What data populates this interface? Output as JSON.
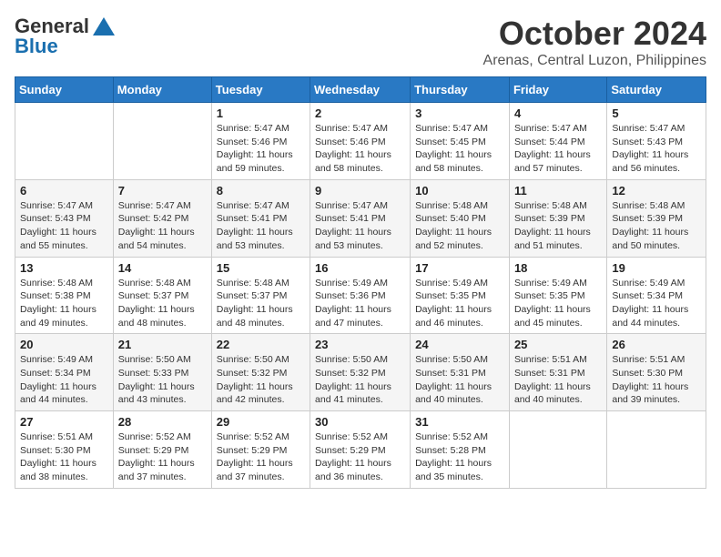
{
  "logo": {
    "general": "General",
    "blue": "Blue"
  },
  "title": {
    "month": "October 2024",
    "location": "Arenas, Central Luzon, Philippines"
  },
  "calendar": {
    "headers": [
      "Sunday",
      "Monday",
      "Tuesday",
      "Wednesday",
      "Thursday",
      "Friday",
      "Saturday"
    ],
    "weeks": [
      [
        {
          "day": "",
          "info": ""
        },
        {
          "day": "",
          "info": ""
        },
        {
          "day": "1",
          "info": "Sunrise: 5:47 AM\nSunset: 5:46 PM\nDaylight: 11 hours\nand 59 minutes."
        },
        {
          "day": "2",
          "info": "Sunrise: 5:47 AM\nSunset: 5:46 PM\nDaylight: 11 hours\nand 58 minutes."
        },
        {
          "day": "3",
          "info": "Sunrise: 5:47 AM\nSunset: 5:45 PM\nDaylight: 11 hours\nand 58 minutes."
        },
        {
          "day": "4",
          "info": "Sunrise: 5:47 AM\nSunset: 5:44 PM\nDaylight: 11 hours\nand 57 minutes."
        },
        {
          "day": "5",
          "info": "Sunrise: 5:47 AM\nSunset: 5:43 PM\nDaylight: 11 hours\nand 56 minutes."
        }
      ],
      [
        {
          "day": "6",
          "info": "Sunrise: 5:47 AM\nSunset: 5:43 PM\nDaylight: 11 hours\nand 55 minutes."
        },
        {
          "day": "7",
          "info": "Sunrise: 5:47 AM\nSunset: 5:42 PM\nDaylight: 11 hours\nand 54 minutes."
        },
        {
          "day": "8",
          "info": "Sunrise: 5:47 AM\nSunset: 5:41 PM\nDaylight: 11 hours\nand 53 minutes."
        },
        {
          "day": "9",
          "info": "Sunrise: 5:47 AM\nSunset: 5:41 PM\nDaylight: 11 hours\nand 53 minutes."
        },
        {
          "day": "10",
          "info": "Sunrise: 5:48 AM\nSunset: 5:40 PM\nDaylight: 11 hours\nand 52 minutes."
        },
        {
          "day": "11",
          "info": "Sunrise: 5:48 AM\nSunset: 5:39 PM\nDaylight: 11 hours\nand 51 minutes."
        },
        {
          "day": "12",
          "info": "Sunrise: 5:48 AM\nSunset: 5:39 PM\nDaylight: 11 hours\nand 50 minutes."
        }
      ],
      [
        {
          "day": "13",
          "info": "Sunrise: 5:48 AM\nSunset: 5:38 PM\nDaylight: 11 hours\nand 49 minutes."
        },
        {
          "day": "14",
          "info": "Sunrise: 5:48 AM\nSunset: 5:37 PM\nDaylight: 11 hours\nand 48 minutes."
        },
        {
          "day": "15",
          "info": "Sunrise: 5:48 AM\nSunset: 5:37 PM\nDaylight: 11 hours\nand 48 minutes."
        },
        {
          "day": "16",
          "info": "Sunrise: 5:49 AM\nSunset: 5:36 PM\nDaylight: 11 hours\nand 47 minutes."
        },
        {
          "day": "17",
          "info": "Sunrise: 5:49 AM\nSunset: 5:35 PM\nDaylight: 11 hours\nand 46 minutes."
        },
        {
          "day": "18",
          "info": "Sunrise: 5:49 AM\nSunset: 5:35 PM\nDaylight: 11 hours\nand 45 minutes."
        },
        {
          "day": "19",
          "info": "Sunrise: 5:49 AM\nSunset: 5:34 PM\nDaylight: 11 hours\nand 44 minutes."
        }
      ],
      [
        {
          "day": "20",
          "info": "Sunrise: 5:49 AM\nSunset: 5:34 PM\nDaylight: 11 hours\nand 44 minutes."
        },
        {
          "day": "21",
          "info": "Sunrise: 5:50 AM\nSunset: 5:33 PM\nDaylight: 11 hours\nand 43 minutes."
        },
        {
          "day": "22",
          "info": "Sunrise: 5:50 AM\nSunset: 5:32 PM\nDaylight: 11 hours\nand 42 minutes."
        },
        {
          "day": "23",
          "info": "Sunrise: 5:50 AM\nSunset: 5:32 PM\nDaylight: 11 hours\nand 41 minutes."
        },
        {
          "day": "24",
          "info": "Sunrise: 5:50 AM\nSunset: 5:31 PM\nDaylight: 11 hours\nand 40 minutes."
        },
        {
          "day": "25",
          "info": "Sunrise: 5:51 AM\nSunset: 5:31 PM\nDaylight: 11 hours\nand 40 minutes."
        },
        {
          "day": "26",
          "info": "Sunrise: 5:51 AM\nSunset: 5:30 PM\nDaylight: 11 hours\nand 39 minutes."
        }
      ],
      [
        {
          "day": "27",
          "info": "Sunrise: 5:51 AM\nSunset: 5:30 PM\nDaylight: 11 hours\nand 38 minutes."
        },
        {
          "day": "28",
          "info": "Sunrise: 5:52 AM\nSunset: 5:29 PM\nDaylight: 11 hours\nand 37 minutes."
        },
        {
          "day": "29",
          "info": "Sunrise: 5:52 AM\nSunset: 5:29 PM\nDaylight: 11 hours\nand 37 minutes."
        },
        {
          "day": "30",
          "info": "Sunrise: 5:52 AM\nSunset: 5:29 PM\nDaylight: 11 hours\nand 36 minutes."
        },
        {
          "day": "31",
          "info": "Sunrise: 5:52 AM\nSunset: 5:28 PM\nDaylight: 11 hours\nand 35 minutes."
        },
        {
          "day": "",
          "info": ""
        },
        {
          "day": "",
          "info": ""
        }
      ]
    ]
  }
}
